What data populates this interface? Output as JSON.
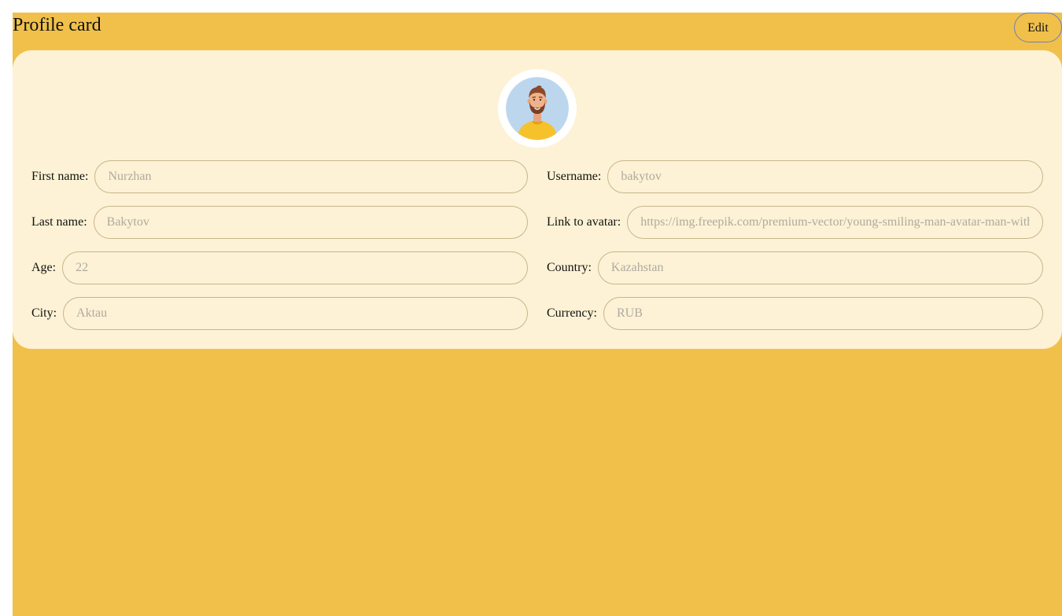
{
  "header": {
    "title": "Profile card",
    "edit_label": "Edit"
  },
  "avatar": {
    "icon": "user-avatar-illustration"
  },
  "fields": {
    "first_name": {
      "label": "First name:",
      "value": "Nurzhan"
    },
    "last_name": {
      "label": "Last name:",
      "value": "Bakytov"
    },
    "age": {
      "label": "Age:",
      "value": "22"
    },
    "city": {
      "label": "City:",
      "value": "Aktau"
    },
    "username": {
      "label": "Username:",
      "value": "bakytov"
    },
    "avatar_link": {
      "label": "Link to avatar:",
      "value": "https://img.freepik.com/premium-vector/young-smiling-man-avatar-man-with"
    },
    "country": {
      "label": "Country:",
      "value": "Kazahstan"
    },
    "currency": {
      "label": "Currency:",
      "value": "RUB"
    }
  },
  "colors": {
    "page_background": "#f0c04a",
    "card_background": "#fdf2d5",
    "accent_border": "#6f7fb8"
  }
}
